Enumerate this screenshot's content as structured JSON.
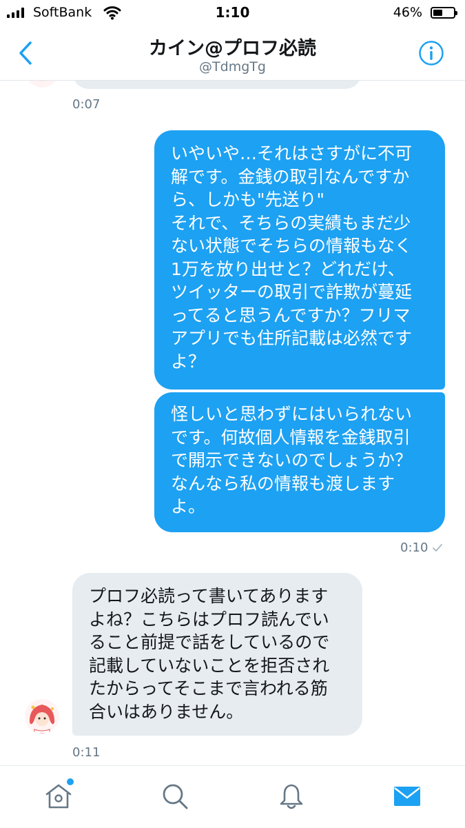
{
  "status_bar": {
    "carrier": "SoftBank",
    "time": "1:10",
    "battery_percent": "46%",
    "battery_level": 0.46
  },
  "header": {
    "title": "カイン@プロフ必読",
    "handle": "@TdmgTg"
  },
  "messages": [
    {
      "direction": "incoming",
      "text": "",
      "timestamp": "0:07"
    },
    {
      "direction": "outgoing",
      "text": "いやいや…それはさすがに不可\n解です。金銭の取引なんですか\nら、しかも\"先送り\"\nそれで、そちらの実績もまだ少\nない状態でそちらの情報もなく\n1万を放り出せと？どれだけ、\nツイッターの取引で詐欺が蔓延\nってると思うんですか？フリマ\nアプリでも住所記載は必然です\nよ？"
    },
    {
      "direction": "outgoing",
      "text": "怪しいと思わずにはいられない\nです。何故個人情報を金銭取引\nで開示できないのでしょうか？\nなんなら私の情報も渡します\nよ。",
      "timestamp": "0:10"
    },
    {
      "direction": "incoming",
      "text": "プロフ必読って書いてあります\nよね？こちらはプロフ読んでい\nること前提で話をしているので\n記載していないことを拒否され\nたからってそこまで言われる筋\n合いはありません。",
      "timestamp": "0:11"
    }
  ],
  "tab_bar": {
    "tabs": [
      "home-icon",
      "search-icon",
      "bell-icon",
      "mail-icon"
    ],
    "active": "mail-icon",
    "accent": "#1da1f2"
  },
  "colors": {
    "accent": "#1da1f2",
    "incoming_bubble": "#e6ecf0",
    "outgoing_bubble": "#1da1f2",
    "secondary_text": "#657786"
  }
}
